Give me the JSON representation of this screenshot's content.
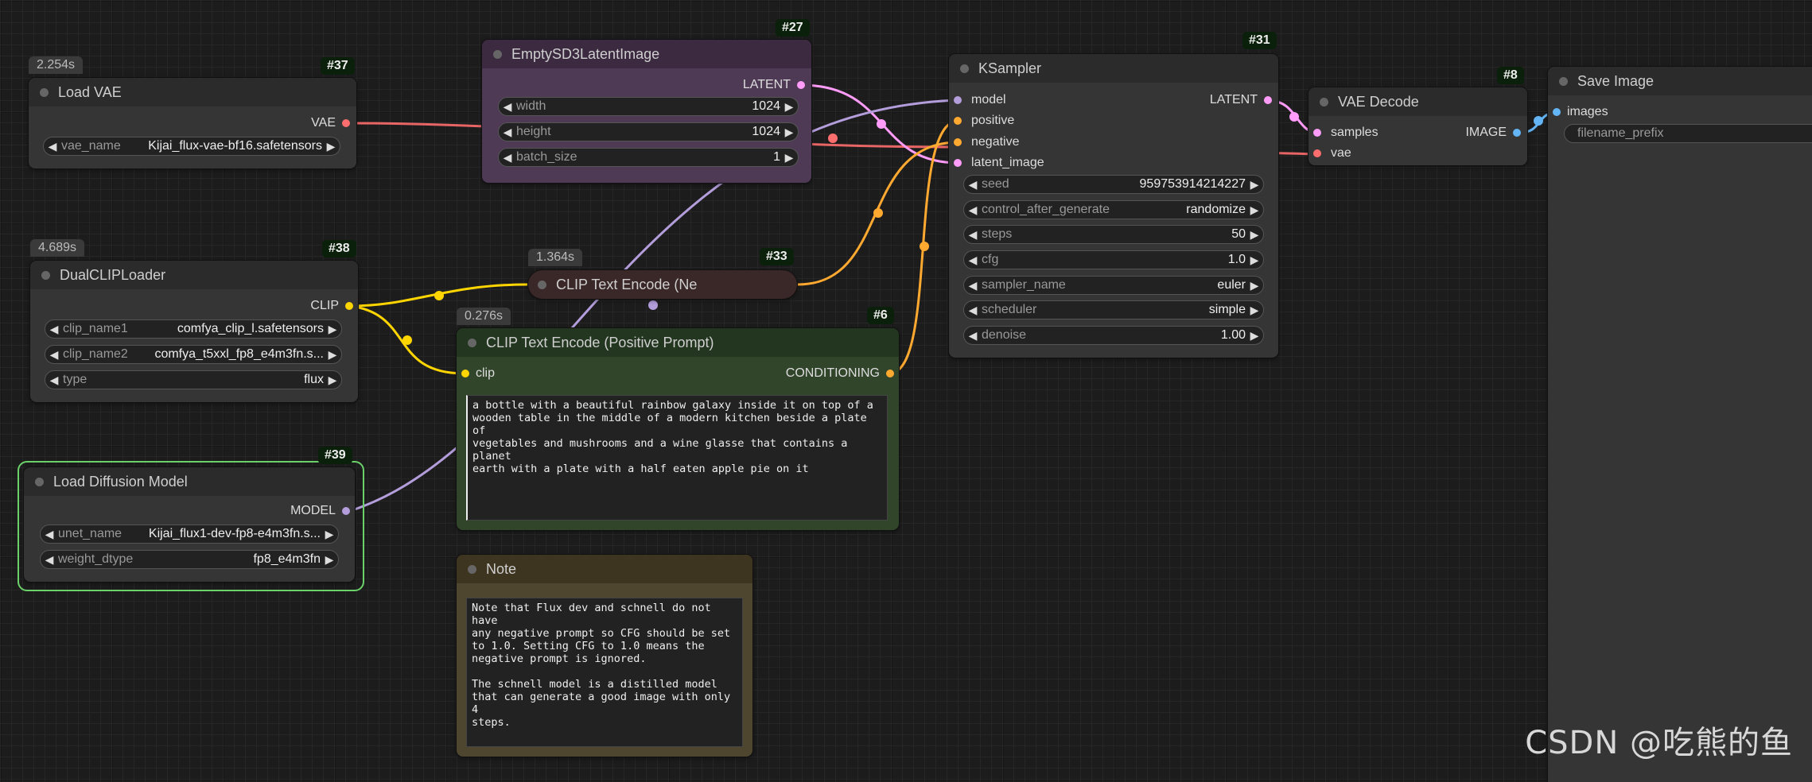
{
  "nodes": {
    "load_vae": {
      "title": "Load VAE",
      "id": "#37",
      "time": "2.254s",
      "output": "VAE",
      "widgets": [
        {
          "name": "vae_name",
          "value": "Kijai_flux-vae-bf16.safetensors"
        }
      ]
    },
    "empty_latent": {
      "title": "EmptySD3LatentImage",
      "id": "#27",
      "output": "LATENT",
      "widgets": [
        {
          "name": "width",
          "value": "1024"
        },
        {
          "name": "height",
          "value": "1024"
        },
        {
          "name": "batch_size",
          "value": "1"
        }
      ]
    },
    "dual_clip": {
      "title": "DualCLIPLoader",
      "id": "#38",
      "time": "4.689s",
      "output": "CLIP",
      "widgets": [
        {
          "name": "clip_name1",
          "value": "comfya_clip_l.safetensors"
        },
        {
          "name": "clip_name2",
          "value": "comfya_t5xxl_fp8_e4m3fn.s..."
        },
        {
          "name": "type",
          "value": "flux"
        }
      ]
    },
    "clip_neg": {
      "title": "CLIP Text Encode (Ne",
      "id": "#33",
      "time": "1.364s"
    },
    "clip_pos": {
      "title": "CLIP Text Encode (Positive Prompt)",
      "id": "#6",
      "time": "0.276s",
      "input": "clip",
      "output": "CONDITIONING",
      "text": "a bottle with a beautiful rainbow galaxy inside it on top of a\nwooden table in the middle of a modern kitchen beside a plate of\nvegetables and mushrooms and a wine glasse that contains a planet\nearth with a plate with a half eaten apple pie on it"
    },
    "load_diffusion": {
      "title": "Load Diffusion Model",
      "id": "#39",
      "output": "MODEL",
      "widgets": [
        {
          "name": "unet_name",
          "value": "Kijai_flux1-dev-fp8-e4m3fn.s..."
        },
        {
          "name": "weight_dtype",
          "value": "fp8_e4m3fn"
        }
      ]
    },
    "note": {
      "title": "Note",
      "text": "Note that Flux dev and schnell do not have\nany negative prompt so CFG should be set\nto 1.0. Setting CFG to 1.0 means the\nnegative prompt is ignored.\n\nThe schnell model is a distilled model\nthat can generate a good image with only 4\nsteps."
    },
    "ksampler": {
      "title": "KSampler",
      "id": "#31",
      "inputs": [
        "model",
        "positive",
        "negative",
        "latent_image"
      ],
      "output": "LATENT",
      "widgets": [
        {
          "name": "seed",
          "value": "959753914214227"
        },
        {
          "name": "control_after_generate",
          "value": "randomize"
        },
        {
          "name": "steps",
          "value": "50"
        },
        {
          "name": "cfg",
          "value": "1.0"
        },
        {
          "name": "sampler_name",
          "value": "euler"
        },
        {
          "name": "scheduler",
          "value": "simple"
        },
        {
          "name": "denoise",
          "value": "1.00"
        }
      ]
    },
    "vae_decode": {
      "title": "VAE Decode",
      "id": "#8",
      "inputs": [
        "samples",
        "vae"
      ],
      "output": "IMAGE"
    },
    "save_image": {
      "title": "Save Image",
      "input": "images",
      "widgets": [
        {
          "name": "filename_prefix",
          "value": ""
        }
      ]
    }
  },
  "watermark": "CSDN @吃熊的鱼",
  "colors": {
    "vae": "#ff6e6e",
    "latent": "#ff9cf9",
    "clip": "#ffd500",
    "conditioning": "#ffa931",
    "model": "#b39ddb",
    "image": "#64b5f6",
    "latent_node": "#4f3a55",
    "latent_head": "#3b2a40",
    "pos_node": "#31452b",
    "pos_head": "#233620",
    "neg_head": "#3a2727",
    "note_node": "#4f4630",
    "note_head": "#3e3520"
  }
}
